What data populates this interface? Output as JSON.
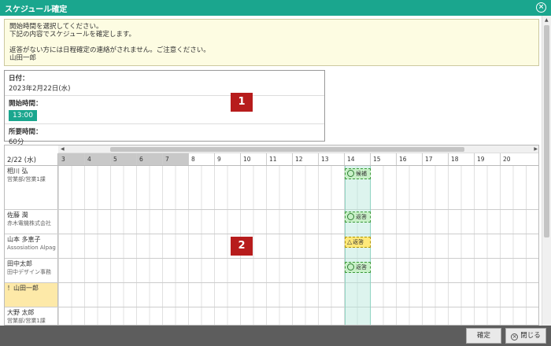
{
  "dialog": {
    "title": "スケジュール確定",
    "close_icon": "close-icon"
  },
  "notice": {
    "line1": "開始時間を選択してください。",
    "line2": "下記の内容でスケジュールを確定します。",
    "line3": "返答がない方には日程確定の連絡がされません。ご注意ください。",
    "line4": "山田一郎"
  },
  "info": {
    "date_label": "日付：",
    "date_value": "2023年2月22日(水)",
    "start_label": "開始時間：",
    "start_value": "13:00",
    "duration_label": "所要時間：",
    "duration_value": "60分"
  },
  "badges": {
    "b1": "1",
    "b2": "2"
  },
  "grid": {
    "date": "2/22 (水)",
    "hours": [
      "3",
      "4",
      "5",
      "6",
      "7",
      "8",
      "9",
      "10",
      "11",
      "12",
      "13",
      "14",
      "15",
      "16",
      "17",
      "18",
      "19",
      "20"
    ],
    "participants": [
      {
        "name": "相川 弘",
        "org": "営業部/営業1課",
        "response": "候補"
      },
      {
        "name": "佐藤 潤",
        "org": "赤木電機株式会社",
        "response": "返答"
      },
      {
        "name": "山本 多恵子",
        "org": "Assosiation Alpag",
        "response": "返答"
      },
      {
        "name": "田中太郎",
        "org": "田中デザイン事務",
        "response": "返答"
      },
      {
        "name": "！山田一郎",
        "org": "",
        "response": ""
      },
      {
        "name": "大野 太郎",
        "org": "営業部/営業1課",
        "response": ""
      }
    ]
  },
  "footer": {
    "confirm_label": "確定",
    "close_label": "閉じる"
  },
  "colors": {
    "accent": "#1aa68e",
    "badge": "#b71c1c",
    "notice_bg": "#fdfce2",
    "self_highlight": "#fde9a8"
  }
}
